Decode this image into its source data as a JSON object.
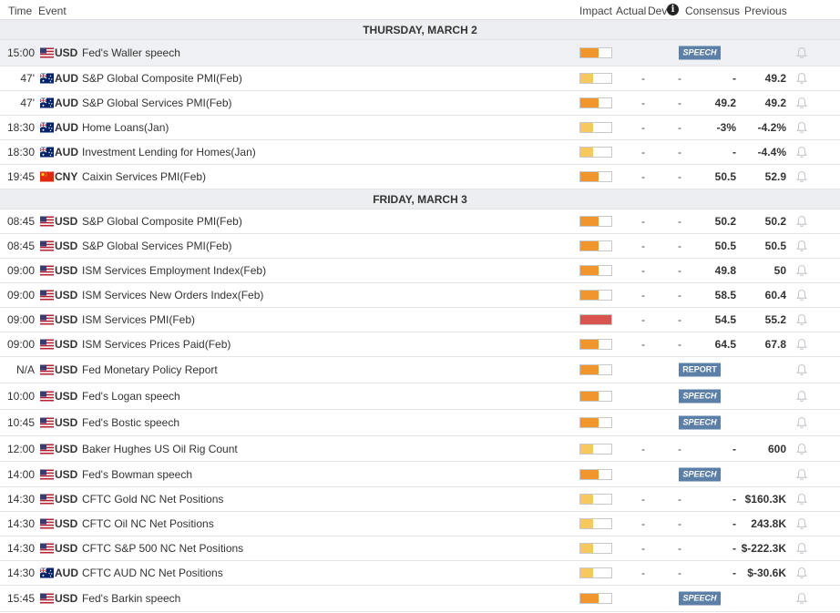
{
  "header": {
    "time": "Time",
    "event": "Event",
    "impact": "Impact",
    "actual": "Actual",
    "dev": "Dev",
    "info_icon": "i",
    "consensus": "Consensus",
    "previous": "Previous"
  },
  "colors": {
    "impact_high": "#d9534f",
    "impact_medium": "#f0962d",
    "impact_low": "#f6c95e",
    "badge": "#5b7fa6"
  },
  "days": [
    {
      "date": "THURSDAY, MARCH 2",
      "events": [
        {
          "time": "15:00",
          "flag": "us-flag-icon",
          "currency": "USD",
          "name": "Fed's Waller speech",
          "impact": "medium",
          "actual": "",
          "dev": "",
          "consensus": "",
          "previous": "",
          "badge": "SPEECH",
          "highlighted": true
        },
        {
          "time": "47'",
          "flag": "au-flag-icon",
          "currency": "AUD",
          "name": "S&P Global Composite PMI(Feb)",
          "impact": "low",
          "actual": "-",
          "dev": "-",
          "consensus": "-",
          "previous": "49.2"
        },
        {
          "time": "47'",
          "flag": "au-flag-icon",
          "currency": "AUD",
          "name": "S&P Global Services PMI(Feb)",
          "impact": "medium",
          "actual": "-",
          "dev": "-",
          "consensus": "49.2",
          "previous": "49.2"
        },
        {
          "time": "18:30",
          "flag": "au-flag-icon",
          "currency": "AUD",
          "name": "Home Loans(Jan)",
          "impact": "low",
          "actual": "-",
          "dev": "-",
          "consensus": "-3%",
          "previous": "-4.2%"
        },
        {
          "time": "18:30",
          "flag": "au-flag-icon",
          "currency": "AUD",
          "name": "Investment Lending for Homes(Jan)",
          "impact": "low",
          "actual": "-",
          "dev": "-",
          "consensus": "-",
          "previous": "-4.4%"
        },
        {
          "time": "19:45",
          "flag": "cn-flag-icon",
          "currency": "CNY",
          "name": "Caixin Services PMI(Feb)",
          "impact": "medium",
          "actual": "-",
          "dev": "-",
          "consensus": "50.5",
          "previous": "52.9"
        }
      ]
    },
    {
      "date": "FRIDAY, MARCH 3",
      "events": [
        {
          "time": "08:45",
          "flag": "us-flag-icon",
          "currency": "USD",
          "name": "S&P Global Composite PMI(Feb)",
          "impact": "medium",
          "actual": "-",
          "dev": "-",
          "consensus": "50.2",
          "previous": "50.2"
        },
        {
          "time": "08:45",
          "flag": "us-flag-icon",
          "currency": "USD",
          "name": "S&P Global Services PMI(Feb)",
          "impact": "medium",
          "actual": "-",
          "dev": "-",
          "consensus": "50.5",
          "previous": "50.5"
        },
        {
          "time": "09:00",
          "flag": "us-flag-icon",
          "currency": "USD",
          "name": "ISM Services Employment Index(Feb)",
          "impact": "medium",
          "actual": "-",
          "dev": "-",
          "consensus": "49.8",
          "previous": "50"
        },
        {
          "time": "09:00",
          "flag": "us-flag-icon",
          "currency": "USD",
          "name": "ISM Services New Orders Index(Feb)",
          "impact": "medium",
          "actual": "-",
          "dev": "-",
          "consensus": "58.5",
          "previous": "60.4"
        },
        {
          "time": "09:00",
          "flag": "us-flag-icon",
          "currency": "USD",
          "name": "ISM Services PMI(Feb)",
          "impact": "high",
          "actual": "-",
          "dev": "-",
          "consensus": "54.5",
          "previous": "55.2"
        },
        {
          "time": "09:00",
          "flag": "us-flag-icon",
          "currency": "USD",
          "name": "ISM Services Prices Paid(Feb)",
          "impact": "medium",
          "actual": "-",
          "dev": "-",
          "consensus": "64.5",
          "previous": "67.8"
        },
        {
          "time": "N/A",
          "flag": "us-flag-icon",
          "currency": "USD",
          "name": "Fed Monetary Policy Report",
          "impact": "medium",
          "actual": "",
          "dev": "",
          "consensus": "",
          "previous": "",
          "badge": "REPORT"
        },
        {
          "time": "10:00",
          "flag": "us-flag-icon",
          "currency": "USD",
          "name": "Fed's Logan speech",
          "impact": "medium",
          "actual": "",
          "dev": "",
          "consensus": "",
          "previous": "",
          "badge": "SPEECH"
        },
        {
          "time": "10:45",
          "flag": "us-flag-icon",
          "currency": "USD",
          "name": "Fed's Bostic speech",
          "impact": "medium",
          "actual": "",
          "dev": "",
          "consensus": "",
          "previous": "",
          "badge": "SPEECH"
        },
        {
          "time": "12:00",
          "flag": "us-flag-icon",
          "currency": "USD",
          "name": "Baker Hughes US Oil Rig Count",
          "impact": "low",
          "actual": "-",
          "dev": "-",
          "consensus": "-",
          "previous": "600"
        },
        {
          "time": "14:00",
          "flag": "us-flag-icon",
          "currency": "USD",
          "name": "Fed's Bowman speech",
          "impact": "medium",
          "actual": "",
          "dev": "",
          "consensus": "",
          "previous": "",
          "badge": "SPEECH"
        },
        {
          "time": "14:30",
          "flag": "us-flag-icon",
          "currency": "USD",
          "name": "CFTC Gold NC Net Positions",
          "impact": "low",
          "actual": "-",
          "dev": "-",
          "consensus": "-",
          "previous": "$160.3K"
        },
        {
          "time": "14:30",
          "flag": "us-flag-icon",
          "currency": "USD",
          "name": "CFTC Oil NC Net Positions",
          "impact": "low",
          "actual": "-",
          "dev": "-",
          "consensus": "-",
          "previous": "243.8K"
        },
        {
          "time": "14:30",
          "flag": "us-flag-icon",
          "currency": "USD",
          "name": "CFTC S&P 500 NC Net Positions",
          "impact": "low",
          "actual": "-",
          "dev": "-",
          "consensus": "-",
          "previous": "$-222.3K"
        },
        {
          "time": "14:30",
          "flag": "au-flag-icon",
          "currency": "AUD",
          "name": "CFTC AUD NC Net Positions",
          "impact": "low",
          "actual": "-",
          "dev": "-",
          "consensus": "-",
          "previous": "$-30.6K"
        },
        {
          "time": "15:45",
          "flag": "us-flag-icon",
          "currency": "USD",
          "name": "Fed's Barkin speech",
          "impact": "medium",
          "actual": "",
          "dev": "",
          "consensus": "",
          "previous": "",
          "badge": "SPEECH"
        }
      ]
    }
  ]
}
